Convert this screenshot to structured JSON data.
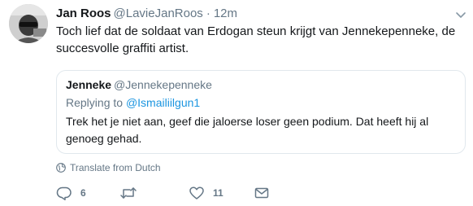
{
  "tweet": {
    "author_name": "Jan Roos",
    "author_handle": "@LavieJanRoos",
    "separator": "·",
    "timestamp": "12m",
    "text_line1": "Toch lief dat de soldaat van Erdogan steun krijgt van Jennekepenneke, de",
    "text_line2": "succesvolle graffiti artist."
  },
  "quoted_tweet": {
    "author_name": "Jenneke",
    "author_handle": "@Jennekepenneke",
    "replying_prefix": "Replying to",
    "replying_handle": "@Ismailiilgun1",
    "text_line1": "Trek het je niet aan, geef die jaloerse loser geen podium. Dat heeft hij al",
    "text_line2": "genoeg gehad."
  },
  "translate_label": "Translate from Dutch",
  "actions": {
    "reply_count": "6",
    "retweet_count": "",
    "like_count": "11"
  },
  "icons": [
    "avatar",
    "caret-down-icon",
    "globe-icon",
    "reply-icon",
    "retweet-icon",
    "heart-icon",
    "envelope-icon"
  ],
  "colors": {
    "text_primary": "#14171a",
    "text_secondary": "#657786",
    "link": "#1b95e0",
    "border": "#e1e8ed"
  }
}
